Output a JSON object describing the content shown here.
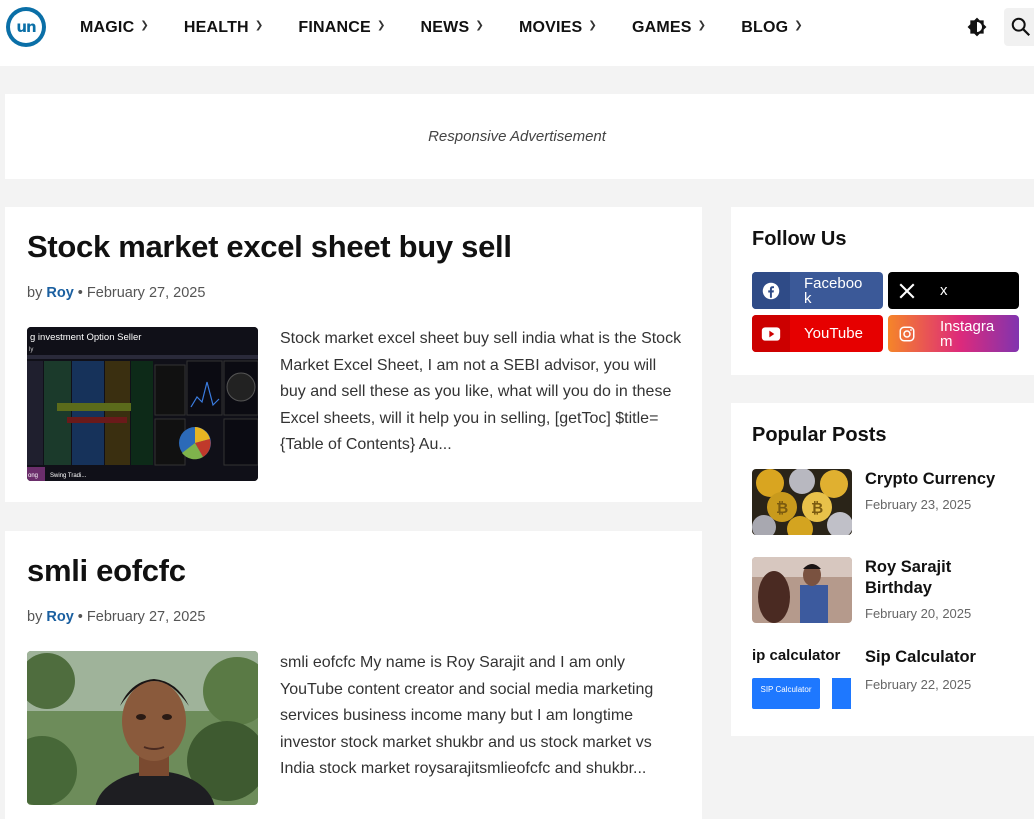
{
  "header": {
    "logo_text": "un",
    "nav": [
      {
        "label": "MAGIC"
      },
      {
        "label": "HEALTH"
      },
      {
        "label": "FINANCE"
      },
      {
        "label": "NEWS"
      },
      {
        "label": "MOVIES"
      },
      {
        "label": "GAMES"
      },
      {
        "label": "BLOG"
      }
    ],
    "icons": {
      "theme": "contrast-icon",
      "search": "search-icon",
      "nav_chevron": "chevron-down-icon"
    }
  },
  "ad": {
    "text": "Responsive Advertisement"
  },
  "posts": [
    {
      "title": "Stock market excel sheet buy sell",
      "by": "by",
      "author": "Roy",
      "sep": "•",
      "date": "February 27, 2025",
      "thumb_caption": "g investment Option Seller",
      "thumb_footer_a": "ong",
      "thumb_footer_b": "Swing Tradi...",
      "excerpt": "Stock market excel sheet buy sell india what is the Stock Market Excel Sheet, I am not a SEBI advisor, you will buy and sell these as you like, what will you do in these Excel sheets, will it help you in selling, [getToc] $title={Table of Contents} Au..."
    },
    {
      "title": "smli eofcfc",
      "by": "by",
      "author": "Roy",
      "sep": "•",
      "date": "February 27, 2025",
      "excerpt": "smli eofcfc My name is Roy Sarajit and I am only YouTube content creator and social media marketing services business income many but I am longtime investor stock market shukbr and us  stock market vs India stock market roysarajitsmlieofcfc and shukbr..."
    }
  ],
  "sidebar": {
    "follow_title": "Follow Us",
    "social": [
      {
        "label": "Faceboo\nk",
        "icon": "facebook-icon",
        "color": "#3b5998"
      },
      {
        "label": "x",
        "icon": "x-icon",
        "color": "#000000"
      },
      {
        "label": "YouTube",
        "icon": "youtube-icon",
        "color": "#e60000"
      },
      {
        "label": "Instagra\nm",
        "icon": "instagram-icon",
        "color": "#d6249f"
      }
    ],
    "popular_title": "Popular Posts",
    "popular": [
      {
        "title": "Crypto Currency",
        "date": "February 23, 2025"
      },
      {
        "title": "Roy Sarajit Birthday",
        "date": "February 20, 2025"
      },
      {
        "title": "Sip Calculator",
        "date": "February 22, 2025",
        "thumb_heading": "ip calculator",
        "thumb_button": "SIP Calculator"
      }
    ]
  },
  "colors": {
    "accent": "#1a5fa0",
    "logo": "#0a6fa7",
    "background": "#f3f3f3"
  }
}
